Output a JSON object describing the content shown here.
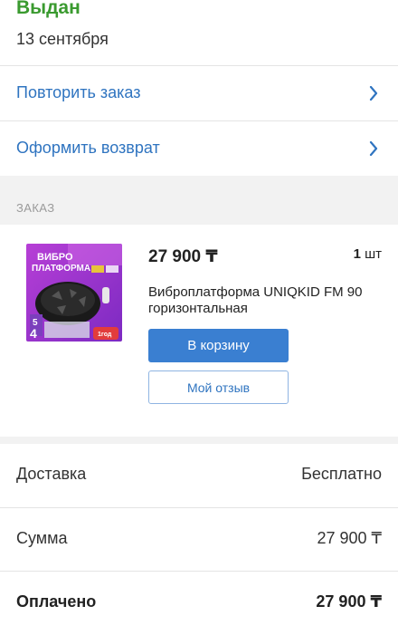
{
  "status": {
    "title": "Выдан",
    "date": "13 сентября"
  },
  "actions": [
    {
      "label": "Повторить заказ",
      "icon": "chevron-right-icon"
    },
    {
      "label": "Оформить возврат",
      "icon": "chevron-right-icon"
    }
  ],
  "section": {
    "label": "ЗАКАЗ"
  },
  "order_item": {
    "price": "27 900 ₸",
    "quantity": "1",
    "quantity_unit": "шт",
    "name": "Виброплатформа UNIQKID FM 90 горизонтальная",
    "cart_button": "В корзину",
    "review_button": "Мой отзыв",
    "image_text": {
      "line1": "ВИБРО",
      "line2": "ПЛАТФОРМА",
      "badge_num": "5",
      "badge_num2": "4",
      "brand": "1год"
    }
  },
  "summary": [
    {
      "label": "Доставка",
      "value": "Бесплатно"
    },
    {
      "label": "Сумма",
      "value": "27 900 ₸"
    },
    {
      "label": "Оплачено",
      "value": "27 900 ₸"
    }
  ],
  "colors": {
    "status_green": "#3a9a2f",
    "link_blue": "#2f74c0",
    "button_blue": "#3a7fd1",
    "section_bg": "#f2f2f2"
  }
}
